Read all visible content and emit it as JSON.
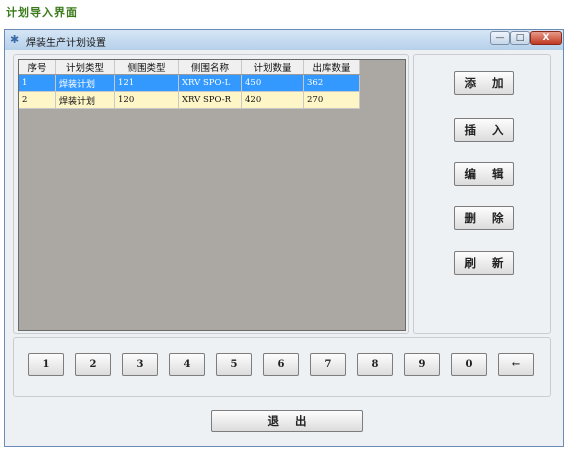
{
  "caption": "计划导入界面",
  "window": {
    "title": "焊装生产计划设置",
    "minimize": "—",
    "maximize": "□",
    "close": "X"
  },
  "grid": {
    "headers": [
      "序号",
      "计划类型",
      "侧围类型",
      "侧围名称",
      "计划数量",
      "出库数量"
    ],
    "rows": [
      [
        "1",
        "焊装计划",
        "121",
        "XRV SPO-L",
        "450",
        "362"
      ],
      [
        "2",
        "焊装计划",
        "120",
        "XRV SPO-R",
        "420",
        "270"
      ]
    ],
    "selected_row": 0
  },
  "actions": {
    "add": "添 加",
    "insert": "插 入",
    "edit": "编 辑",
    "delete": "删 除",
    "refresh": "刷 新"
  },
  "keypad": [
    "1",
    "2",
    "3",
    "4",
    "5",
    "6",
    "7",
    "8",
    "9",
    "0",
    "←"
  ],
  "exit_label": "退 出",
  "colors": {
    "selected_row": "#3399ff",
    "alt_row": "#fff6c8",
    "grid_background": "#aba8a3",
    "caption": "#3a7a1a"
  }
}
